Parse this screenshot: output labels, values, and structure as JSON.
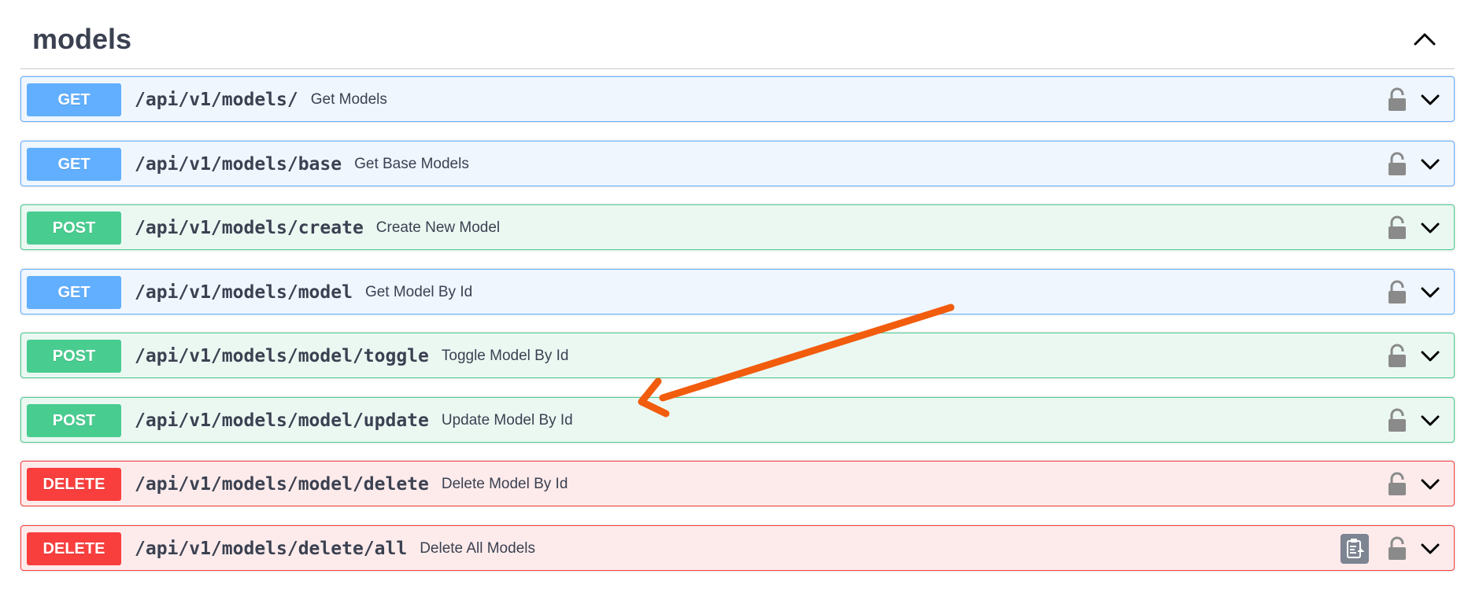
{
  "tag": {
    "title": "models",
    "collapse_icon": "chevron-up-icon"
  },
  "colors": {
    "get": "#61affe",
    "post": "#49cc90",
    "delete": "#f93e3e",
    "annotation_arrow": "#f25c0d"
  },
  "operations": [
    {
      "method": "GET",
      "path": "/api/v1/models/",
      "summary": "Get Models"
    },
    {
      "method": "GET",
      "path": "/api/v1/models/base",
      "summary": "Get Base Models"
    },
    {
      "method": "POST",
      "path": "/api/v1/models/create",
      "summary": "Create New Model"
    },
    {
      "method": "GET",
      "path": "/api/v1/models/model",
      "summary": "Get Model By Id"
    },
    {
      "method": "POST",
      "path": "/api/v1/models/model/toggle",
      "summary": "Toggle Model By Id"
    },
    {
      "method": "POST",
      "path": "/api/v1/models/model/update",
      "summary": "Update Model By Id"
    },
    {
      "method": "DELETE",
      "path": "/api/v1/models/model/delete",
      "summary": "Delete Model By Id"
    },
    {
      "method": "DELETE",
      "path": "/api/v1/models/delete/all",
      "summary": "Delete All Models",
      "has_copy_button": true
    }
  ],
  "icons": {
    "lock": "unlocked-padlock-icon",
    "expand": "chevron-down-icon",
    "copy": "clipboard-copy-icon"
  }
}
